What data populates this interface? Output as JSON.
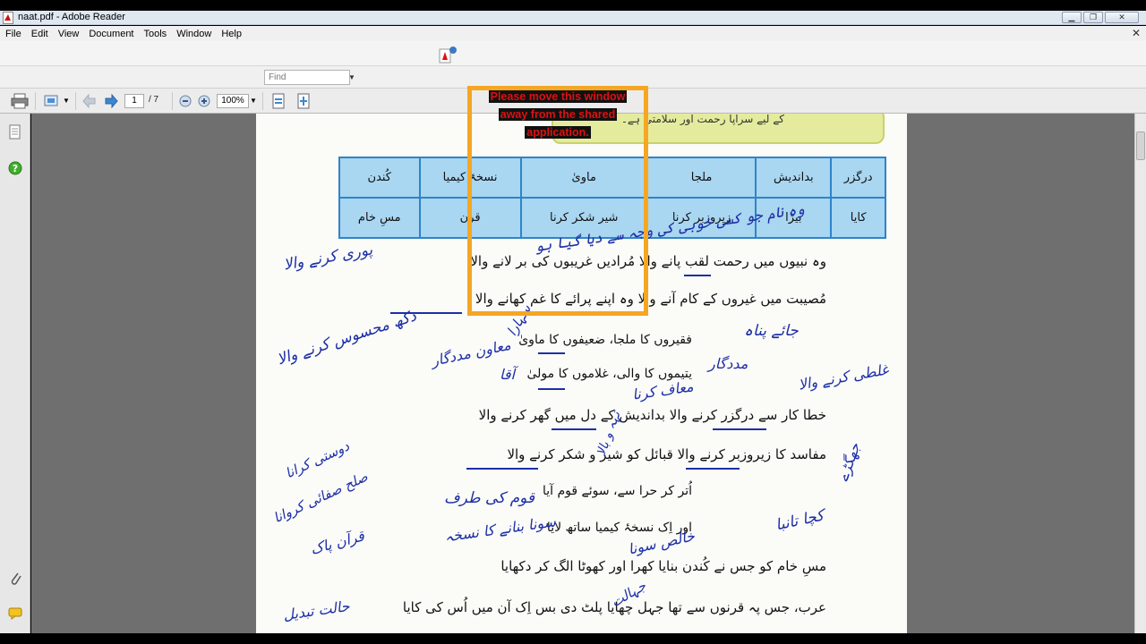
{
  "window": {
    "title": "naat.pdf - Adobe Reader"
  },
  "menu": [
    "File",
    "Edit",
    "View",
    "Document",
    "Tools",
    "Window",
    "Help"
  ],
  "toolbar": {
    "find_placeholder": "Find",
    "current_page": "1",
    "page_total": "/ 7",
    "zoom": "100%"
  },
  "overlay": {
    "line1": "Please move this window",
    "line2": "away from the shared",
    "line3": "application."
  },
  "document": {
    "banner_text": "کے لیے سراپا رحمت اور سلامتی ہے۔",
    "table_headers": [
      "درگزر",
      "بداندیش",
      "ملجا",
      "ماویٰ",
      "نسخۂ کیمیا",
      "کُندن"
    ],
    "table_row": [
      "کایا",
      "بیڑا",
      "زیروزبر کرنا",
      "شیر شکر کرنا",
      "قرن",
      "مسِ خام"
    ],
    "lines": [
      "وہ نبیوں میں رحمت لقب پانے والا     مُرادیں غریبوں کی بر لانے والا",
      "مُصیبت میں غیروں کے کام آنے والا     وہ اپنے پرائے کا غم کھانے والا",
      "فقیروں کا ملجا، ضعیفوں کا ماویٰ",
      "یتیموں کا والی، غلاموں کا مولیٰ",
      "خطا کار سے درگزر کرنے والا     بداندیش کے دل میں گھر کرنے والا",
      "مفاسد کا زیروزبر کرنے والا     قبائل کو شیر و شکر کرنے والا",
      "اُتر کر حرا سے، سوئے قوم آیا",
      "اور اِک نسخۂ کیمیا ساتھ لایا",
      "مسِ خام کو جس نے کُندن بنایا     کھرا اور کھوٹا الگ کر دکھایا",
      "عرب، جس پہ قرنوں سے تھا جہل چھایا     پلٹ دی بس اِک آن میں اُس کی کایا"
    ],
    "annotations": [
      "وہ نام جو کسی خوبی کی وجہ سے دیا گیا ہو",
      "پوری کرنے والا",
      "دکھ محسوس کرنے والا",
      "جائے پناہ",
      "مددگار",
      "سہارا",
      "معاون مددگار",
      "آقا",
      "غلطی کرنے والا",
      "معاف کرنا",
      "تہہ و بالا",
      "جھگڑے",
      "دوستی کرانا",
      "صلح صفائی کروانا",
      "قوم کی طرف",
      "قرآن پاک",
      "سونا بنانے کا نسخہ",
      "کچا تانبا",
      "خالص سونا",
      "جہالت",
      "حالت تبدیل"
    ]
  }
}
